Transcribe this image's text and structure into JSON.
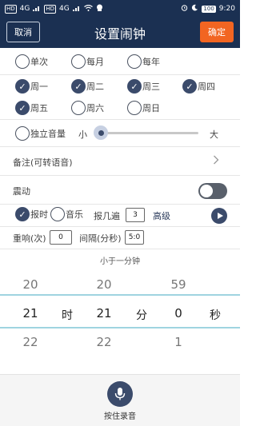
{
  "status_bar": {
    "hd1": "HD",
    "net1": "4G",
    "hd2": "HD",
    "net2": "4G",
    "battery": "100",
    "time": "9:20"
  },
  "header": {
    "cancel_label": "取消",
    "title": "设置闹钟",
    "confirm_label": "确定"
  },
  "repeat": {
    "once": "单次",
    "monthly": "每月",
    "yearly": "每年"
  },
  "weekdays": {
    "mon": "周一",
    "tue": "周二",
    "wed": "周三",
    "thu": "周四",
    "fri": "周五",
    "sat": "周六",
    "sun": "周日"
  },
  "volume": {
    "label": "独立音量",
    "min_label": "小",
    "max_label": "大",
    "level": 0
  },
  "note": {
    "label": "备注(可转语音)"
  },
  "vibrate": {
    "label": "震动",
    "on": false
  },
  "sound": {
    "report_label": "报时",
    "music_label": "音乐",
    "repeat_times_label": "报几遍",
    "repeat_times_value": "3",
    "advanced_label": "高级"
  },
  "snooze": {
    "count_label": "重响(次)",
    "count_value": "0",
    "interval_label": "间隔(分秒)",
    "interval_value": "5:0"
  },
  "picker": {
    "hint": "小于一分钟",
    "hours": [
      "20",
      "21",
      "22"
    ],
    "minutes": [
      "20",
      "21",
      "22"
    ],
    "seconds": [
      "59",
      "0",
      "1"
    ],
    "hour_unit": "时",
    "minute_unit": "分",
    "second_unit": "秒"
  },
  "bottom": {
    "record_label": "按住录音"
  },
  "colors": {
    "header_bg": "#1b3052",
    "accent": "#f26522",
    "check": "#3b4b6b"
  }
}
